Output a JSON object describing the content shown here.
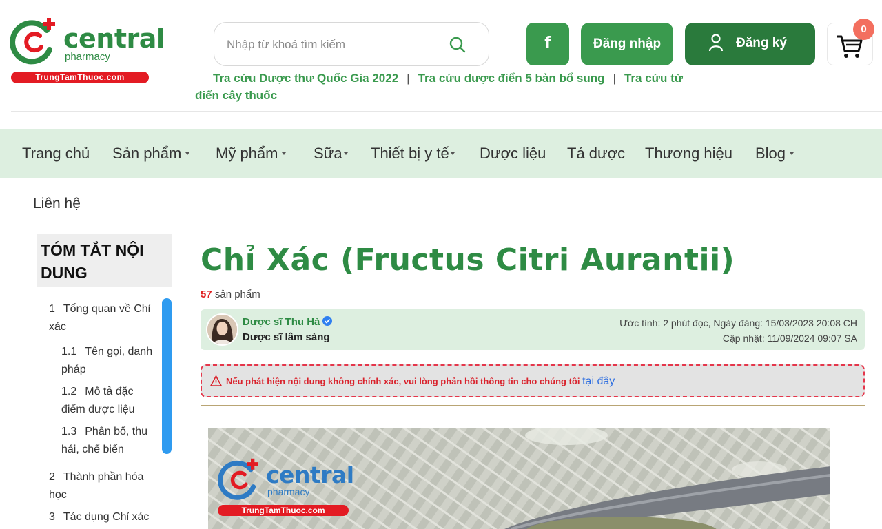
{
  "brand": {
    "name": "central",
    "sub": "pharmacy",
    "site": "TrungTamThuoc.com",
    "colors": {
      "green": "#2e8b44",
      "red": "#e31b23",
      "nav_bg": "#ddefe0"
    }
  },
  "search": {
    "placeholder": "Nhập từ khoá tìm kiếm",
    "icon": "search-icon"
  },
  "header": {
    "facebook_label": "f",
    "login_label": "Đăng nhập",
    "register_label": "Đăng ký",
    "cart_count": "0"
  },
  "quick_links": [
    {
      "label": "Tra cứu Dược thư Quốc Gia 2022"
    },
    {
      "label": "Tra cứu dược điển 5 bản bổ sung"
    },
    {
      "label": "Tra cứu từ điển cây thuốc"
    }
  ],
  "nav": [
    {
      "label": "Trang chủ"
    },
    {
      "label": "Sản phẩm"
    },
    {
      "label": "Mỹ phẩm"
    },
    {
      "label": "Sữa"
    },
    {
      "label": "Thiết bị y tế"
    },
    {
      "label": "Dược liệu"
    },
    {
      "label": "Tá dược"
    },
    {
      "label": "Thương hiệu"
    },
    {
      "label": "Blog"
    }
  ],
  "breadcrumb": "Liên hệ",
  "toc": {
    "title": "TÓM TẮT NỘI DUNG",
    "items": [
      {
        "num": "1",
        "label": "Tổng quan về Chỉ xác"
      },
      {
        "num": "1.1",
        "label": "Tên gọi, danh pháp"
      },
      {
        "num": "1.2",
        "label": "Mô tả đặc điểm dược liệu"
      },
      {
        "num": "1.3",
        "label": "Phân bố, thu hái, chế biến"
      },
      {
        "num": "2",
        "label": "Thành phần hóa học"
      },
      {
        "num": "3",
        "label": "Tác dụng Chỉ xác"
      }
    ]
  },
  "article": {
    "title": "Chỉ Xác (Fructus Citri Aurantii)",
    "product_count": "57",
    "product_label": "sản phẩm",
    "author_name": "Dược sĩ Thu Hà",
    "author_role": "Dược sĩ lâm sàng",
    "meta_line1": "Ước tính: 2 phút đọc, Ngày đăng: 15/03/2023 20:08 CH",
    "meta_line2": "Cập nhật: 11/09/2024 09:07 SA",
    "warning_text": "Nếu phát hiện nội dung không chính xác, vui lòng phản hồi thông tin cho chúng tôi",
    "warning_link": "tại đây"
  }
}
